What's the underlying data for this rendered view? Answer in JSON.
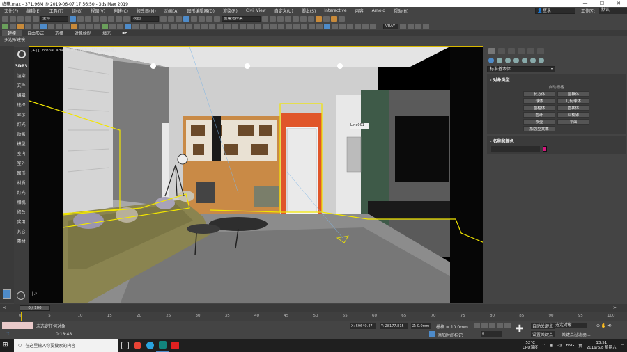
{
  "window": {
    "title": "临摹.max - 371.96M @ 2019-06-07 17:56:50 - 3ds Max 2019"
  },
  "menu": [
    "文件(F)",
    "编辑(E)",
    "工具(T)",
    "组(G)",
    "视图(V)",
    "创建(C)",
    "修改器(M)",
    "动画(A)",
    "图形编辑器(D)",
    "渲染(R)",
    "Civil View",
    "自定义(U)",
    "脚本(S)",
    "Interactive",
    "内容",
    "Arnold",
    "帮助(H)"
  ],
  "menu_right": {
    "user": "登录",
    "workspace_label": "工作区:",
    "workspace": "默认"
  },
  "toolbar1": {
    "selection_filter": "全部",
    "coord_system": "视图",
    "named_set": "创建选择集"
  },
  "toolbar2": {
    "readout": "VRAY"
  },
  "ribbon_tabs": [
    "建模",
    "自由形式",
    "选择",
    "对象绘制",
    "填充"
  ],
  "ribbon_sub": "多边形建模",
  "left_panel": [
    "3DP3",
    "渲染",
    "文件",
    "编辑",
    "选择",
    "显示",
    "灯光",
    "动画",
    "模型",
    "室内",
    "室外",
    "图形",
    "材质",
    "灯光",
    "相机",
    "修改",
    "实用",
    "其它",
    "素材"
  ],
  "viewport": {
    "label": "[+] [CoronaCamera001] [标准] [默认明暗处理]",
    "object_tag": "Line001",
    "colors": {
      "selection": "#f2e600",
      "orange_wall": "#e0562a",
      "green_wall": "#3e5a48"
    }
  },
  "command_panel": {
    "dropdown": "标准基本体",
    "object_type": {
      "title": "对象类型",
      "autogrid": "自动栅格",
      "buttons": [
        "长方体",
        "圆锥体",
        "球体",
        "几何球体",
        "圆柱体",
        "管状体",
        "圆环",
        "四棱锥",
        "茶壶",
        "平面",
        "加强型文本"
      ]
    },
    "name_color": {
      "title": "名称和颜色",
      "color": "#d6167e"
    }
  },
  "timeline": {
    "frame": "0 / 100",
    "ticks": [
      0,
      5,
      10,
      15,
      20,
      25,
      30,
      35,
      40,
      45,
      50,
      55,
      60,
      65,
      70,
      75,
      80,
      85,
      90,
      95,
      100
    ]
  },
  "status": {
    "selection": "未选定任何对象",
    "time": "0:18:48",
    "x": "X: 59640.47",
    "y": "Y: 28177.815",
    "z": "Z: 0.0mm",
    "grid": "栅格 = 10.0mm",
    "add_time_tag": "添加时间标记",
    "auto_key": "自动关键点",
    "set_key": "设置关键点",
    "selected": "选定对象",
    "key_filter": "关键点过滤器...",
    "frame_field": "0"
  },
  "taskbar": {
    "search": "在这里输入你要搜索的内容",
    "weather": "52°C",
    "weather_label": "CPU温度",
    "lang": "ENG",
    "clock": "13:51",
    "date": "2019/6/8 星期六"
  }
}
